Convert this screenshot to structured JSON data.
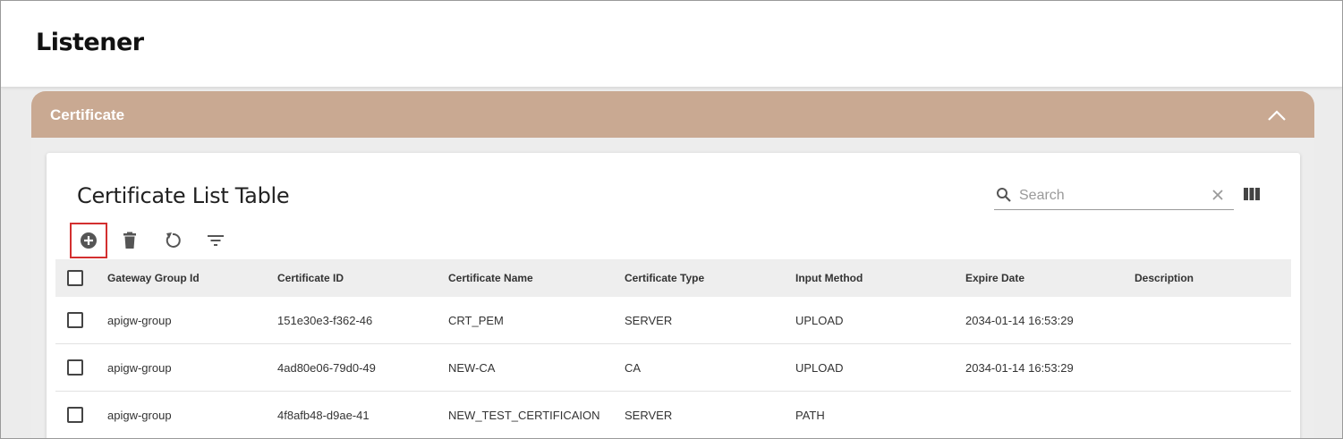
{
  "page": {
    "title": "Listener"
  },
  "panel": {
    "title": "Certificate",
    "collapse_icon": "chevron-up-icon",
    "header_color": "#c9a992"
  },
  "card": {
    "title": "Certificate List Table",
    "search": {
      "placeholder": "Search",
      "value": ""
    },
    "toolbar": {
      "add_icon": "add-circle-icon",
      "delete_icon": "trash-icon",
      "refresh_icon": "refresh-icon",
      "filter_icon": "filter-icon",
      "highlight_color": "#d32f2f"
    }
  },
  "table": {
    "columns": [
      "Gateway Group Id",
      "Certificate ID",
      "Certificate Name",
      "Certificate Type",
      "Input Method",
      "Expire Date",
      "Description"
    ],
    "rows": [
      [
        "apigw-group",
        "151e30e3-f362-46",
        "CRT_PEM",
        "SERVER",
        "UPLOAD",
        "2034-01-14 16:53:29",
        ""
      ],
      [
        "apigw-group",
        "4ad80e06-79d0-49",
        "NEW-CA",
        "CA",
        "UPLOAD",
        "2034-01-14 16:53:29",
        ""
      ],
      [
        "apigw-group",
        "4f8afb48-d9ae-41",
        "NEW_TEST_CERTIFICAION",
        "SERVER",
        "PATH",
        "",
        ""
      ]
    ]
  }
}
